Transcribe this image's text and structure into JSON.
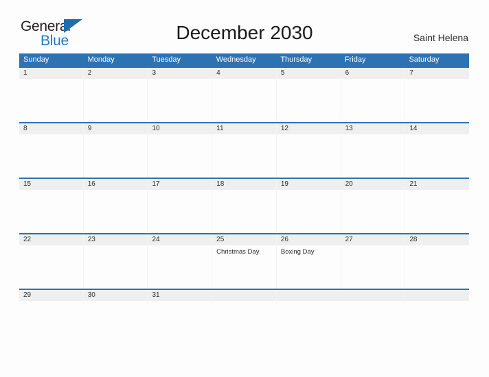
{
  "brand": {
    "name_top": "General",
    "name_bottom": "Blue",
    "flag_icon": "triangle-flag-icon",
    "color_dark": "#231f20",
    "color_blue": "#1e77c4"
  },
  "header": {
    "title": "December 2030",
    "location": "Saint Helena"
  },
  "theme": {
    "accent_blue": "#2d72b3",
    "band_gray": "#efefef",
    "page_background": "#fdfdfd",
    "text_color": "#2b2b2b"
  },
  "calendar": {
    "month": "December",
    "year": "2030",
    "weekday_headers": [
      "Sunday",
      "Monday",
      "Tuesday",
      "Wednesday",
      "Thursday",
      "Friday",
      "Saturday"
    ],
    "weeks": [
      {
        "days": [
          {
            "number": "1",
            "events": []
          },
          {
            "number": "2",
            "events": []
          },
          {
            "number": "3",
            "events": []
          },
          {
            "number": "4",
            "events": []
          },
          {
            "number": "5",
            "events": []
          },
          {
            "number": "6",
            "events": []
          },
          {
            "number": "7",
            "events": []
          }
        ]
      },
      {
        "days": [
          {
            "number": "8",
            "events": []
          },
          {
            "number": "9",
            "events": []
          },
          {
            "number": "10",
            "events": []
          },
          {
            "number": "11",
            "events": []
          },
          {
            "number": "12",
            "events": []
          },
          {
            "number": "13",
            "events": []
          },
          {
            "number": "14",
            "events": []
          }
        ]
      },
      {
        "days": [
          {
            "number": "15",
            "events": []
          },
          {
            "number": "16",
            "events": []
          },
          {
            "number": "17",
            "events": []
          },
          {
            "number": "18",
            "events": []
          },
          {
            "number": "19",
            "events": []
          },
          {
            "number": "20",
            "events": []
          },
          {
            "number": "21",
            "events": []
          }
        ]
      },
      {
        "days": [
          {
            "number": "22",
            "events": []
          },
          {
            "number": "23",
            "events": []
          },
          {
            "number": "24",
            "events": []
          },
          {
            "number": "25",
            "events": [
              "Christmas Day"
            ]
          },
          {
            "number": "26",
            "events": [
              "Boxing Day"
            ]
          },
          {
            "number": "27",
            "events": []
          },
          {
            "number": "28",
            "events": []
          }
        ]
      },
      {
        "days": [
          {
            "number": "29",
            "events": []
          },
          {
            "number": "30",
            "events": []
          },
          {
            "number": "31",
            "events": []
          },
          {
            "number": "",
            "events": []
          },
          {
            "number": "",
            "events": []
          },
          {
            "number": "",
            "events": []
          },
          {
            "number": "",
            "events": []
          }
        ]
      }
    ]
  }
}
